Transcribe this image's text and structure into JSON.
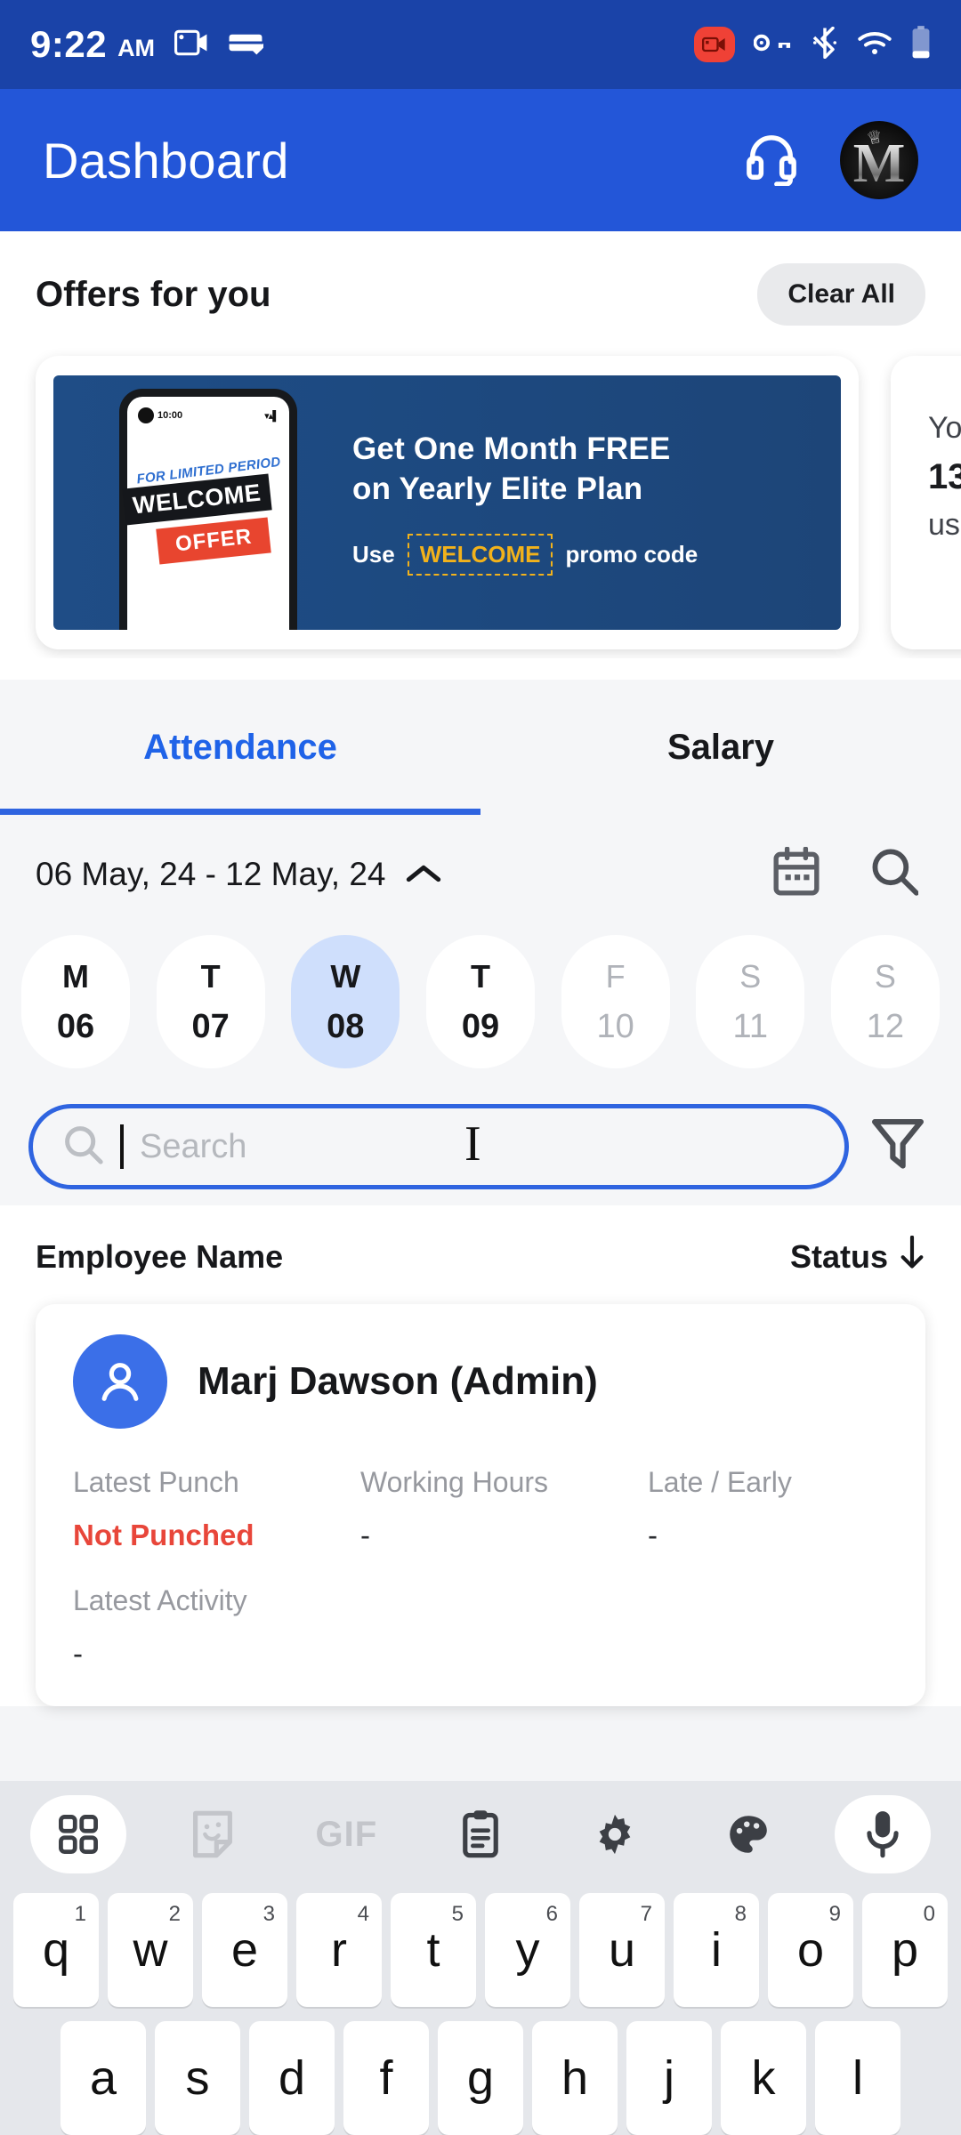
{
  "status_bar": {
    "time": "9:22",
    "ampm": "AM",
    "icons": [
      "screen-record-icon",
      "cast-icon",
      "recording-badge-icon",
      "vpn-key-icon",
      "bluetooth-icon",
      "wifi-icon",
      "battery-icon"
    ]
  },
  "app_bar": {
    "title": "Dashboard",
    "support_icon": "headset-icon",
    "avatar_letter": "M"
  },
  "offers": {
    "title": "Offers for you",
    "clear_all_label": "Clear All",
    "banner": {
      "phone_time": "10:00",
      "limited_text": "FOR LIMITED PERIOD",
      "welcome_text": "WELCOME",
      "offer_text": "OFFER",
      "headline_line1": "Get One Month FREE",
      "headline_line2": "on Yearly Elite Plan",
      "use_label": "Use",
      "promo_code": "WELCOME",
      "promo_suffix": "promo code"
    },
    "second_card": {
      "line1": "Yo",
      "line2": "13",
      "line3": "us"
    }
  },
  "tabs": {
    "items": [
      {
        "label": "Attendance",
        "active": true
      },
      {
        "label": "Salary",
        "active": false
      }
    ]
  },
  "date_selector": {
    "range": "06 May, 24 - 12 May, 24",
    "chevron": "chevron-up-icon",
    "calendar_icon": "calendar-icon",
    "search_icon": "search-icon",
    "days": [
      {
        "name": "M",
        "num": "06",
        "state": "normal"
      },
      {
        "name": "T",
        "num": "07",
        "state": "normal"
      },
      {
        "name": "W",
        "num": "08",
        "state": "selected"
      },
      {
        "name": "T",
        "num": "09",
        "state": "normal"
      },
      {
        "name": "F",
        "num": "10",
        "state": "dim"
      },
      {
        "name": "S",
        "num": "11",
        "state": "dim"
      },
      {
        "name": "S",
        "num": "12",
        "state": "dim"
      }
    ]
  },
  "search": {
    "placeholder": "Search",
    "value": "",
    "focused": true,
    "filter_icon": "filter-icon"
  },
  "employee_list": {
    "col_name": "Employee Name",
    "col_status": "Status",
    "sort_icon": "arrow-down-icon",
    "rows": [
      {
        "name": "Marj Dawson (Admin)",
        "avatar_icon": "person-icon",
        "latest_punch_label": "Latest Punch",
        "latest_punch_value": "Not Punched",
        "working_hours_label": "Working Hours",
        "working_hours_value": "-",
        "late_early_label": "Late / Early",
        "late_early_value": "-",
        "latest_activity_label": "Latest Activity",
        "latest_activity_value": "-"
      }
    ]
  },
  "keyboard": {
    "toolbar": [
      "apps-grid-icon",
      "sticker-icon",
      "gif-icon",
      "clipboard-icon",
      "settings-gear-icon",
      "palette-icon",
      "microphone-icon"
    ],
    "gif_label": "GIF",
    "row1": [
      {
        "char": "q",
        "num": "1"
      },
      {
        "char": "w",
        "num": "2"
      },
      {
        "char": "e",
        "num": "3"
      },
      {
        "char": "r",
        "num": "4"
      },
      {
        "char": "t",
        "num": "5"
      },
      {
        "char": "y",
        "num": "6"
      },
      {
        "char": "u",
        "num": "7"
      },
      {
        "char": "i",
        "num": "8"
      },
      {
        "char": "o",
        "num": "9"
      },
      {
        "char": "p",
        "num": "0"
      }
    ],
    "row2": [
      {
        "char": "a"
      },
      {
        "char": "s"
      },
      {
        "char": "d"
      },
      {
        "char": "f"
      },
      {
        "char": "g"
      },
      {
        "char": "h"
      },
      {
        "char": "j"
      },
      {
        "char": "k"
      },
      {
        "char": "l"
      }
    ]
  },
  "colors": {
    "status_bar_bg": "#1a43a8",
    "app_bar_bg": "#2356d8",
    "accent_blue": "#2f64e0",
    "selected_day_bg": "#cfdffc",
    "danger_red": "#e8463a",
    "promo_gold": "#f2b21b",
    "keyboard_bg": "#e5e7eb"
  }
}
